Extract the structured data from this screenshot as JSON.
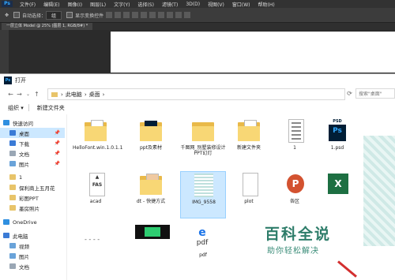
{
  "ps": {
    "menu": [
      "文件(F)",
      "编辑(E)",
      "图像(I)",
      "图层(L)",
      "文字(Y)",
      "选择(S)",
      "滤镜(T)",
      "3D(D)",
      "视图(V)",
      "窗口(W)",
      "帮助(H)"
    ],
    "logo": "Ps",
    "options": {
      "auto_select_label": "自动选择：",
      "auto_select_value": "组",
      "transform_label": "显示变换控件"
    },
    "doc_tab": "一层立体 Model @ 25% (图层 1, RGB/8#) *"
  },
  "dialog": {
    "title": "打开",
    "icon": "Ps",
    "breadcrumb": [
      "此电脑",
      "桌面"
    ],
    "search_placeholder": "搜索\"桌面\"",
    "organize": "组织 ▾",
    "new_folder": "新建文件夹",
    "nav": [
      {
        "label": "快速访问",
        "icon": "star-icon",
        "color": "#2f8fe0",
        "pin": ""
      },
      {
        "label": "桌面",
        "icon": "desktop-icon",
        "color": "#3b7bd6",
        "pin": "📌",
        "selected": true
      },
      {
        "label": "下载",
        "icon": "download-icon",
        "color": "#3b7bd6",
        "pin": "📌"
      },
      {
        "label": "文档",
        "icon": "document-icon",
        "color": "#9aa7b5",
        "pin": "📌"
      },
      {
        "label": "图片",
        "icon": "picture-icon",
        "color": "#6aa3d9",
        "pin": "📌"
      },
      {
        "label": "1",
        "icon": "folder-icon",
        "color": "#e8c46a",
        "pin": ""
      },
      {
        "label": "保利商上五月花",
        "icon": "folder-icon",
        "color": "#e8c46a",
        "pin": ""
      },
      {
        "label": "彩图PPT",
        "icon": "folder-icon",
        "color": "#e8c46a",
        "pin": ""
      },
      {
        "label": "墨房照片",
        "icon": "folder-icon",
        "color": "#e8c46a",
        "pin": ""
      },
      {
        "label": "OneDrive",
        "icon": "cloud-icon",
        "color": "#2f8fe0",
        "pin": ""
      },
      {
        "label": "此电脑",
        "icon": "computer-icon",
        "color": "#3b7bd6",
        "pin": ""
      },
      {
        "label": "视频",
        "icon": "video-icon",
        "color": "#6aa3d9",
        "pin": ""
      },
      {
        "label": "图片",
        "icon": "picture-icon",
        "color": "#6aa3d9",
        "pin": ""
      },
      {
        "label": "文档",
        "icon": "document-icon",
        "color": "#9aa7b5",
        "pin": ""
      }
    ],
    "files": [
      {
        "name": "HelloFont.win.1.0.1.1",
        "kind": "folder-doc"
      },
      {
        "name": "ppt及素材",
        "kind": "folder-ps"
      },
      {
        "name": "千图网_别墅装修设计PPT幻灯",
        "kind": "folder"
      },
      {
        "name": "新建文件夹",
        "kind": "folder-doc"
      },
      {
        "name": "1",
        "kind": "doc-lines"
      },
      {
        "name": "1.psd",
        "kind": "psd"
      },
      {
        "name": "acad",
        "kind": "acad"
      },
      {
        "name": "dt - 快捷方式",
        "kind": "folder-img"
      },
      {
        "name": "IMG_9558",
        "kind": "grid",
        "selected": true
      },
      {
        "name": "plot",
        "kind": "doc-blank"
      },
      {
        "name": "各区",
        "kind": "pp"
      },
      {
        "name": "",
        "kind": "xl"
      },
      {
        "name": "",
        "kind": "dots"
      },
      {
        "name": "",
        "kind": "green"
      },
      {
        "name": "pdf",
        "kind": "pdf"
      }
    ]
  },
  "watermark": {
    "big": "百科全说",
    "small": "助你轻松解决"
  }
}
